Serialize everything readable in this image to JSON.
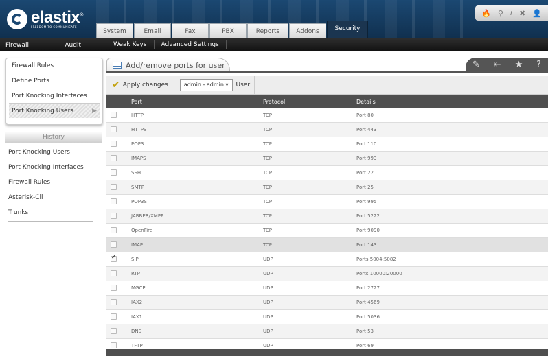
{
  "logo": {
    "name": "elastix",
    "tagline": "FREEDOM TO COMMUNICATE"
  },
  "tabs": [
    {
      "label": "System"
    },
    {
      "label": "Email"
    },
    {
      "label": "Fax"
    },
    {
      "label": "PBX"
    },
    {
      "label": "Reports"
    },
    {
      "label": "Addons"
    },
    {
      "label": "Security"
    }
  ],
  "active_tab": "Security",
  "subnav": {
    "firewall": "Firewall",
    "audit": "Audit",
    "weak_keys": "Weak Keys",
    "advanced": "Advanced Settings"
  },
  "sidebar": {
    "items": [
      {
        "label": "Firewall Rules"
      },
      {
        "label": "Define Ports"
      },
      {
        "label": "Port Knocking Interfaces"
      },
      {
        "label": "Port Knocking Users"
      }
    ],
    "history_label": "History",
    "history": [
      {
        "label": "Port Knocking Users"
      },
      {
        "label": "Port Knocking Interfaces"
      },
      {
        "label": "Firewall Rules"
      },
      {
        "label": "Asterisk-Cli"
      },
      {
        "label": "Trunks"
      }
    ]
  },
  "panel": {
    "title": "Add/remove ports for user",
    "apply_label": "Apply changes",
    "user_select": "admin - admin",
    "user_label": "User"
  },
  "table": {
    "headers": {
      "port": "Port",
      "protocol": "Protocol",
      "details": "Details"
    },
    "rows": [
      {
        "port": "HTTP",
        "protocol": "TCP",
        "details": "Port 80",
        "checked": false
      },
      {
        "port": "HTTPS",
        "protocol": "TCP",
        "details": "Port 443",
        "checked": false
      },
      {
        "port": "POP3",
        "protocol": "TCP",
        "details": "Port 110",
        "checked": false
      },
      {
        "port": "IMAPS",
        "protocol": "TCP",
        "details": "Port 993",
        "checked": false
      },
      {
        "port": "SSH",
        "protocol": "TCP",
        "details": "Port 22",
        "checked": false
      },
      {
        "port": "SMTP",
        "protocol": "TCP",
        "details": "Port 25",
        "checked": false
      },
      {
        "port": "POP3S",
        "protocol": "TCP",
        "details": "Port 995",
        "checked": false
      },
      {
        "port": "JABBER/XMPP",
        "protocol": "TCP",
        "details": "Port 5222",
        "checked": false
      },
      {
        "port": "OpenFire",
        "protocol": "TCP",
        "details": "Port 9090",
        "checked": false
      },
      {
        "port": "IMAP",
        "protocol": "TCP",
        "details": "Port 143",
        "checked": false
      },
      {
        "port": "SIP",
        "protocol": "UDP",
        "details": "Ports 5004:5082",
        "checked": true
      },
      {
        "port": "RTP",
        "protocol": "UDP",
        "details": "Ports 10000:20000",
        "checked": false
      },
      {
        "port": "MGCP",
        "protocol": "UDP",
        "details": "Port 2727",
        "checked": false
      },
      {
        "port": "IAX2",
        "protocol": "UDP",
        "details": "Port 4569",
        "checked": false
      },
      {
        "port": "IAX1",
        "protocol": "UDP",
        "details": "Port 5036",
        "checked": false
      },
      {
        "port": "DNS",
        "protocol": "UDP",
        "details": "Port 53",
        "checked": false
      },
      {
        "port": "TFTP",
        "protocol": "UDP",
        "details": "Port 69",
        "checked": false
      }
    ]
  }
}
